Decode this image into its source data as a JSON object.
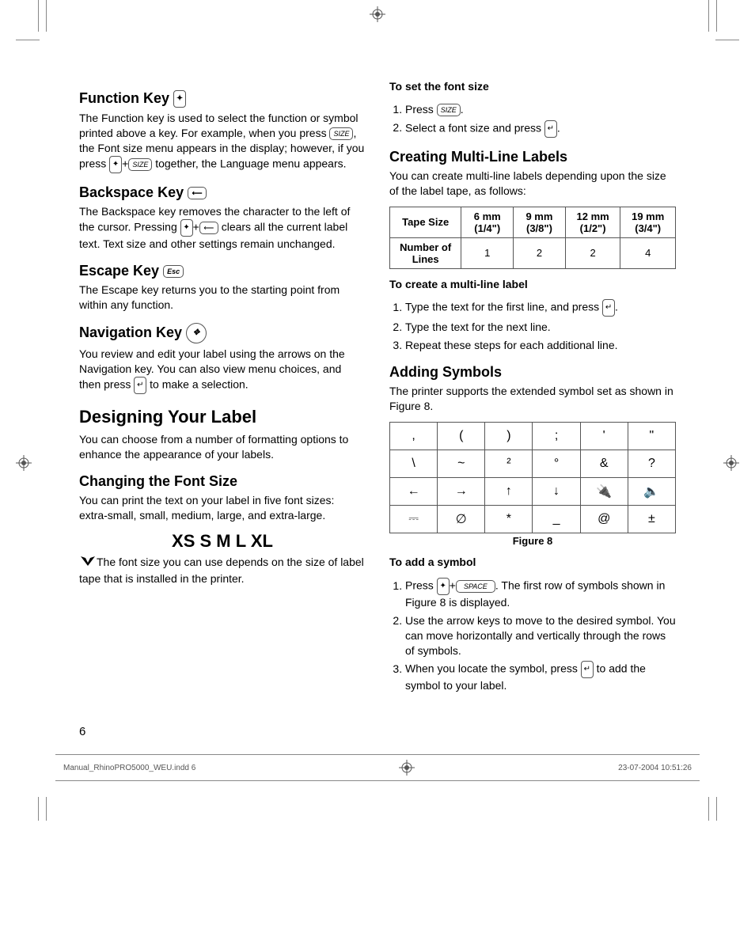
{
  "left": {
    "function_key": {
      "heading": "Function Key",
      "body_a": "The Function key is used to select the function or symbol printed above a key. For example, when you press ",
      "body_b": ", the Font size menu appears in the display; however, if you press ",
      "body_c": " together, the Language menu appears."
    },
    "backspace_key": {
      "heading": "Backspace Key",
      "body_a": "The Backspace key removes the character to the left of the cursor. Pressing ",
      "body_b": " clears all the current label text. Text size and other settings remain unchanged."
    },
    "escape_key": {
      "heading": "Escape Key",
      "body": "The Escape key returns you to the starting point from within any function."
    },
    "navigation_key": {
      "heading": "Navigation Key",
      "body_a": "You review and edit your label using the arrows on the Navigation key. You can also view menu choices, and then press ",
      "body_b": " to make a selection."
    },
    "designing": {
      "heading": "Designing Your Label",
      "body": "You can choose from a number of formatting options to enhance the appearance of your labels."
    },
    "font_size": {
      "heading": "Changing the Font Size",
      "body": "You can print the text on your label in five font sizes: extra-small, small, medium, large, and extra-large.",
      "sizes": "XS S M L XL",
      "tip": "The font size you can use depends on the size of label tape that is installed in the printer."
    }
  },
  "right": {
    "set_font": {
      "heading": "To set the font size",
      "step1_a": "Press ",
      "step1_b": ".",
      "step2_a": "Select a font size and press ",
      "step2_b": "."
    },
    "multiline": {
      "heading": "Creating Multi-Line Labels",
      "body": "You can create multi-line labels depending upon the size of the label tape, as follows:",
      "table": {
        "headers": [
          "Tape Size",
          "6 mm (1/4\")",
          "9 mm (3/8\")",
          "12 mm (1/2\")",
          "19 mm (3/4\")"
        ],
        "row_label": "Number of Lines",
        "row_values": [
          "1",
          "2",
          "2",
          "4"
        ]
      },
      "create_heading": "To create a multi-line label",
      "step1_a": "Type the text for the first line, and press ",
      "step1_b": ".",
      "step2": "Type the text for the next line.",
      "step3": "Repeat these steps for each additional line."
    },
    "symbols": {
      "heading": "Adding Symbols",
      "body": "The printer supports the extended symbol set as shown in Figure 8.",
      "grid": [
        [
          ",",
          "(",
          ")",
          ";",
          "'",
          "\""
        ],
        [
          "\\",
          "~",
          "²",
          "°",
          "&",
          "?"
        ],
        [
          "←",
          "→",
          "↑",
          "↓",
          "🔌",
          "🔈"
        ],
        [
          "⎓",
          "∅",
          "*",
          "_",
          "@",
          "±"
        ]
      ],
      "caption": "Figure 8",
      "add_heading": "To add a symbol",
      "step1_a": "Press ",
      "step1_b": ". The first row of symbols shown in Figure 8 is displayed.",
      "step2": "Use the arrow keys to move to the desired symbol. You can move horizontally and vertically through the rows of symbols.",
      "step3_a": "When you locate the symbol, press ",
      "step3_b": " to add the symbol to your label."
    }
  },
  "keys": {
    "size": "SIZE",
    "fn": "✦",
    "bksp": "⟵",
    "esc": "Esc",
    "enter": "↵",
    "space": "SPACE"
  },
  "page_number": "6",
  "footer": {
    "file": "Manual_RhinoPRO5000_WEU.indd   6",
    "timestamp": "23-07-2004   10:51:26"
  },
  "chart_data": {
    "type": "table",
    "title": "Number of lines supported by tape size",
    "columns": [
      "Tape Size",
      "6 mm (1/4\")",
      "9 mm (3/8\")",
      "12 mm (1/2\")",
      "19 mm (3/4\")"
    ],
    "rows": [
      [
        "Number of Lines",
        1,
        2,
        2,
        4
      ]
    ]
  }
}
